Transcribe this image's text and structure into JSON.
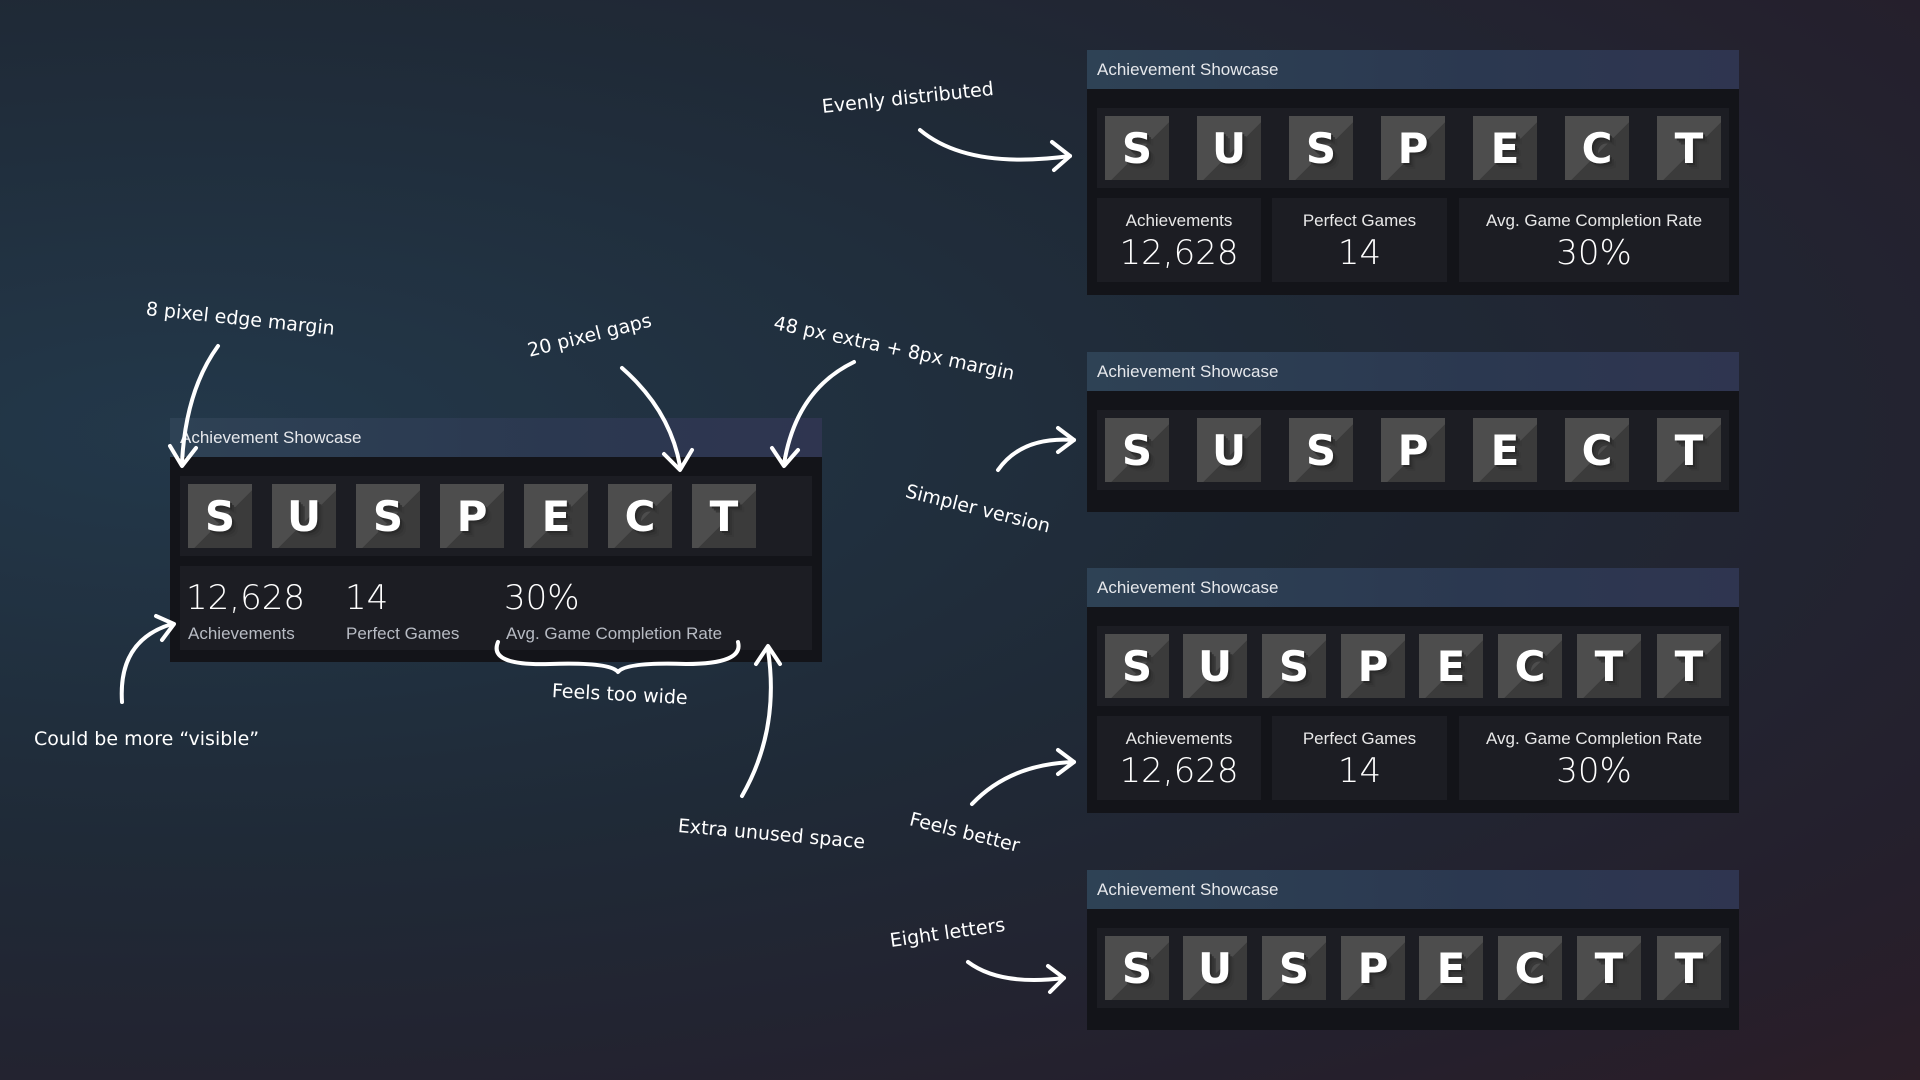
{
  "showcase_title": "Achievement Showcase",
  "letters7": [
    "S",
    "U",
    "S",
    "P",
    "E",
    "C",
    "T"
  ],
  "letters8": [
    "S",
    "U",
    "S",
    "P",
    "E",
    "C",
    "T",
    "T"
  ],
  "stats": {
    "achievements_label": "Achievements",
    "achievements_value": "12,628",
    "perfect_label": "Perfect Games",
    "perfect_value": "14",
    "completion_label": "Avg. Game Completion Rate",
    "completion_value": "30%"
  },
  "annotations": {
    "edge_margin": "8 pixel edge margin",
    "pixel_gaps": "20 pixel gaps",
    "extra_margin": "48 px extra + 8px margin",
    "more_visible": "Could be more “visible”",
    "too_wide": "Feels too wide",
    "unused_space": "Extra unused space",
    "evenly": "Evenly distributed",
    "simpler": "Simpler version",
    "feels_better": "Feels better",
    "eight_letters": "Eight letters"
  }
}
